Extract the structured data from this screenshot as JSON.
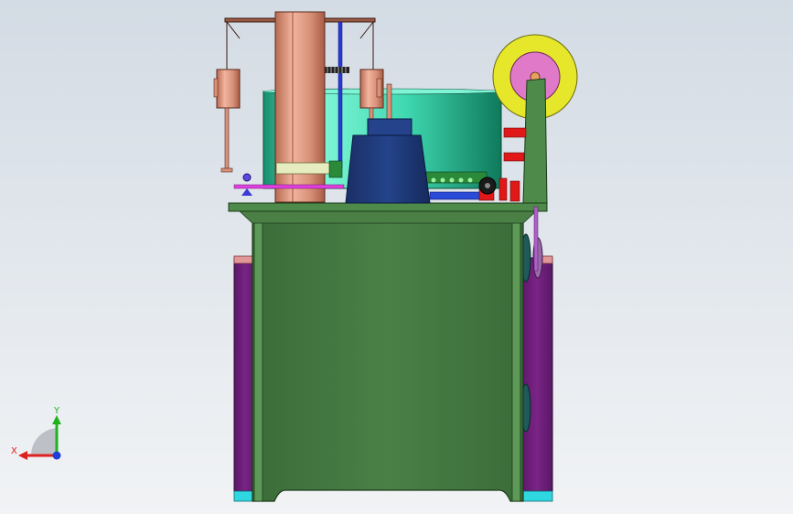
{
  "viewport": {
    "background_top": "#d3dbe4",
    "background_bottom": "#f1f3f5"
  },
  "triad": {
    "x_label": "X",
    "y_label": "Y",
    "x_color": "#e0201e",
    "y_color": "#1fb21f",
    "z_color": "#1e3ed8"
  },
  "colors": {
    "cabinet": "#457a42",
    "side_panel": "#6e1e7a",
    "copper": "#d8917a",
    "teal_drum": "#2fbf9a",
    "blue_housing": "#1e3a78",
    "reel_outer": "#e6e62a",
    "reel_inner": "#e07ac8",
    "red_part": "#e01818",
    "cyan_foot": "#2fd8e0"
  }
}
